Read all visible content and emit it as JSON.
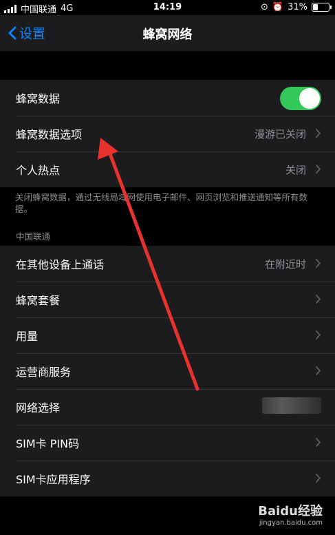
{
  "status_bar": {
    "carrier": "中国联通",
    "network": "4G",
    "time": "14:19",
    "battery_percent": "31%",
    "battery_level": 0.31
  },
  "nav": {
    "back_label": "设置",
    "title": "蜂窝网络"
  },
  "group1": {
    "rows": [
      {
        "label": "蜂窝数据",
        "toggle_on": true
      },
      {
        "label": "蜂窝数据选项",
        "value": "漫游已关闭"
      },
      {
        "label": "个人热点",
        "value": "关闭"
      }
    ],
    "footnote": "关闭蜂窝数据，通过无线局域网使用电子邮件、网页浏览和推送通知等所有数据。"
  },
  "group2": {
    "header": "中国联通",
    "rows": [
      {
        "label": "在其他设备上通话",
        "value": "在附近时"
      },
      {
        "label": "蜂窝套餐",
        "value": ""
      },
      {
        "label": "用量",
        "value": ""
      },
      {
        "label": "运营商服务",
        "value": ""
      },
      {
        "label": "网络选择",
        "value": ""
      },
      {
        "label": "SIM卡 PIN码",
        "value": ""
      },
      {
        "label": "SIM卡应用程序",
        "value": ""
      }
    ]
  },
  "watermark": {
    "brand": "Baidu经验",
    "url": "jingyan.baidu.com"
  },
  "colors": {
    "accent": "#0a84ff",
    "toggle_on": "#34c759",
    "arrow": "#e8322e"
  }
}
